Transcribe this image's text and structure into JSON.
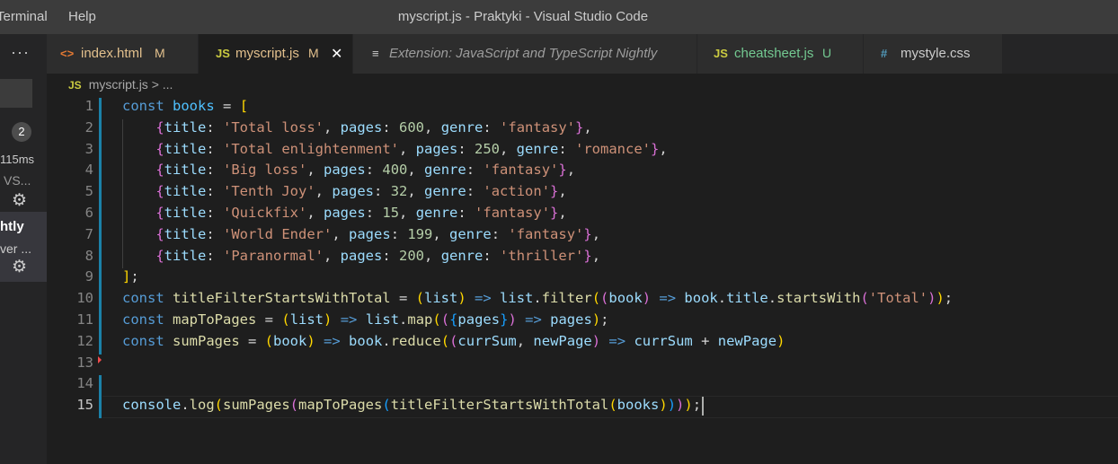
{
  "titlebar": {
    "menu_terminal": "Terminal",
    "menu_help": "Help",
    "window_title": "myscript.js - Praktyki - Visual Studio Code"
  },
  "sidebar": {
    "more": "···",
    "badge": "2",
    "time": "115ms",
    "ext_name": "VS...",
    "selected_name": "htly",
    "selected_desc": "ver ..."
  },
  "tabs": [
    {
      "icon": "html-file-icon",
      "glyph": "<>",
      "label": "index.html",
      "status": "M",
      "color": "#e37933"
    },
    {
      "icon": "js-file-icon",
      "glyph": "JS",
      "label": "myscript.js",
      "status": "M",
      "close": "✕",
      "color": "#cbcb41"
    },
    {
      "icon": "preview-icon",
      "glyph": "≡",
      "label": "Extension: JavaScript and TypeScript Nightly",
      "status": "",
      "color": "#cccccc"
    },
    {
      "icon": "js-file-icon",
      "glyph": "JS",
      "label": "cheatsheet.js",
      "status": "U",
      "color": "#cbcb41"
    },
    {
      "icon": "css-file-icon",
      "glyph": "#",
      "label": "mystyle.css",
      "status": "",
      "color": "#519aba"
    }
  ],
  "breadcrumb": {
    "icon": "JS",
    "file": "myscript.js",
    "sep": ">",
    "more": "..."
  },
  "editor": {
    "line_numbers": [
      "1",
      "2",
      "3",
      "4",
      "5",
      "6",
      "7",
      "8",
      "9",
      "10",
      "11",
      "12",
      "13",
      "14",
      "15"
    ],
    "active_line": "15",
    "books": [
      {
        "title": "Total loss",
        "pages": 600,
        "genre": "fantasy"
      },
      {
        "title": "Total enlightenment",
        "pages": 250,
        "genre": "romance"
      },
      {
        "title": "Big loss",
        "pages": 400,
        "genre": "fantasy"
      },
      {
        "title": "Tenth Joy",
        "pages": 32,
        "genre": "action"
      },
      {
        "title": "Quickfix",
        "pages": 15,
        "genre": "fantasy"
      },
      {
        "title": "World Ender",
        "pages": 199,
        "genre": "fantasy"
      },
      {
        "title": "Paranormal",
        "pages": 200,
        "genre": "thriller"
      }
    ],
    "idents": {
      "kw_const": "const",
      "books": "books",
      "title": "title",
      "pages": "pages",
      "genre": "genre",
      "fn1": "titleFilterStartsWithTotal",
      "fn2": "mapToPages",
      "fn3": "sumPages",
      "list": "list",
      "book": "book",
      "filter": "filter",
      "startsWith": "startsWith",
      "map": "map",
      "reduce": "reduce",
      "currSum": "currSum",
      "newPage": "newPage",
      "console": "console",
      "log": "log",
      "total_str": "'Total'"
    }
  }
}
